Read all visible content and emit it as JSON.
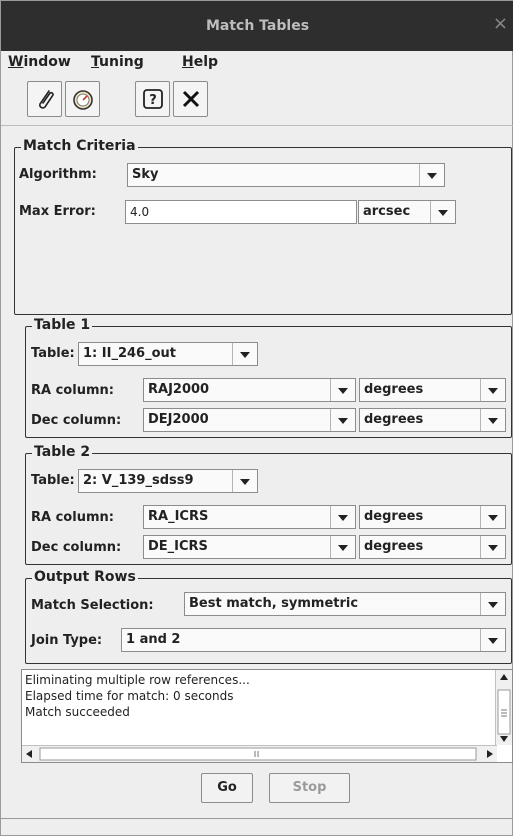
{
  "window": {
    "title": "Match Tables",
    "close_glyph": "×"
  },
  "menubar": {
    "items": [
      {
        "label": "Window",
        "mnemonic": "W",
        "rest": "indow"
      },
      {
        "label": "Tuning",
        "mnemonic": "T",
        "rest": "uning"
      },
      {
        "label": "Help",
        "mnemonic": "H",
        "rest": "elp"
      }
    ]
  },
  "toolbar": {
    "buttons": [
      {
        "icon": "paperclip-icon"
      },
      {
        "icon": "gauge-icon"
      },
      {
        "icon": "help-icon",
        "glyph": "?"
      },
      {
        "icon": "close-icon",
        "glyph": "✕"
      }
    ]
  },
  "match_criteria": {
    "legend": "Match Criteria",
    "algorithm_label": "Algorithm:",
    "algorithm_value": "Sky",
    "max_error_label": "Max Error:",
    "max_error_value": "4.0",
    "max_error_unit": "arcsec"
  },
  "table1": {
    "legend": "Table 1",
    "table_label": "Table:",
    "table_value": "1: II_246_out",
    "ra_label": "RA column:",
    "ra_value": "RAJ2000",
    "ra_unit": "degrees",
    "dec_label": "Dec column:",
    "dec_value": "DEJ2000",
    "dec_unit": "degrees"
  },
  "table2": {
    "legend": "Table 2",
    "table_label": "Table:",
    "table_value": "2: V_139_sdss9",
    "ra_label": "RA column:",
    "ra_value": "RA_ICRS",
    "ra_unit": "degrees",
    "dec_label": "Dec column:",
    "dec_value": "DE_ICRS",
    "dec_unit": "degrees"
  },
  "output_rows": {
    "legend": "Output Rows",
    "selection_label": "Match Selection:",
    "selection_value": "Best match, symmetric",
    "join_label": "Join Type:",
    "join_value": "1 and 2"
  },
  "log": {
    "lines": [
      "Eliminating multiple row references...",
      "Elapsed time for match: 0 seconds",
      "Match succeeded"
    ]
  },
  "actions": {
    "go_label": "Go",
    "stop_label": "Stop"
  },
  "colors": {
    "titlebar": "#2e2e2e",
    "background": "#eeeeee",
    "border": "#333333"
  }
}
